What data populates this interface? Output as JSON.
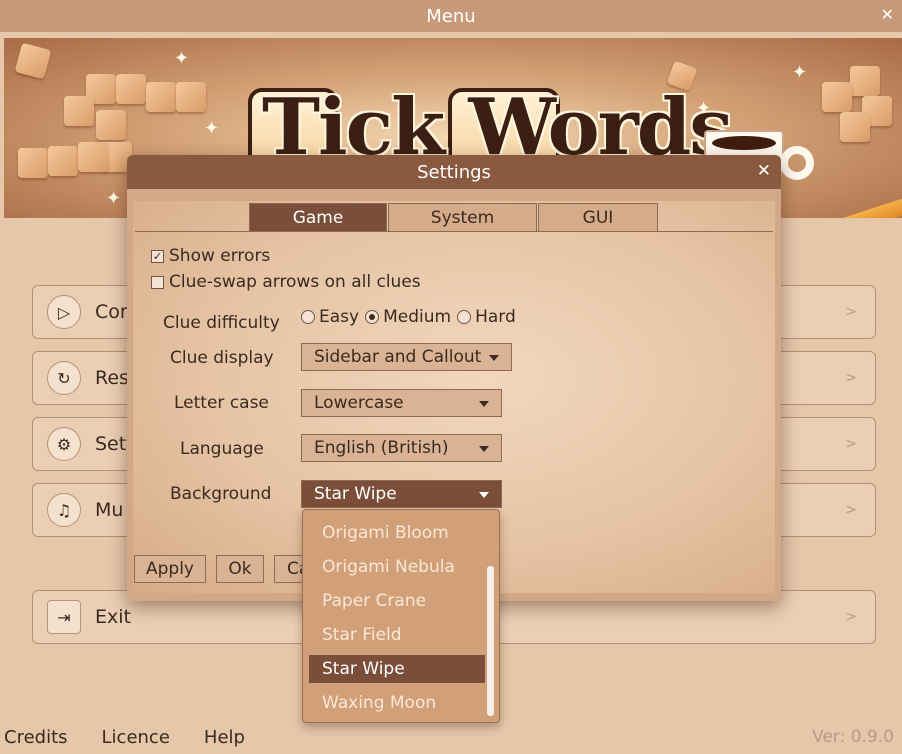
{
  "window": {
    "title": "Menu",
    "close_glyph": "✕"
  },
  "banner": {
    "logo_title": "Tick Words"
  },
  "menu": {
    "items": [
      {
        "label": "Con",
        "icon": "play-icon",
        "glyph": "▷",
        "chevron": ">"
      },
      {
        "label": "Res",
        "icon": "restart-icon",
        "glyph": "↻",
        "chevron": ">"
      },
      {
        "label": "Sett",
        "icon": "gear-icon",
        "glyph": "⚙",
        "chevron": ">"
      },
      {
        "label": "Mu",
        "icon": "music-icon",
        "glyph": "♫",
        "chevron": ">"
      },
      {
        "label": "Exit",
        "icon": "exit-icon",
        "glyph": "⇥",
        "chevron": ">"
      }
    ]
  },
  "footer": {
    "credits": "Credits",
    "licence": "Licence",
    "help": "Help",
    "version": "Ver: 0.9.0"
  },
  "settings": {
    "title": "Settings",
    "close_glyph": "✕",
    "tabs": [
      {
        "label": "Game",
        "active": true
      },
      {
        "label": "System",
        "active": false
      },
      {
        "label": "GUI",
        "active": false
      }
    ],
    "show_errors": {
      "label": "Show errors",
      "checked": true,
      "glyph": "✓"
    },
    "clue_swap": {
      "label": "Clue-swap arrows on all clues",
      "checked": false
    },
    "clue_difficulty": {
      "label": "Clue difficulty",
      "options": [
        "Easy",
        "Medium",
        "Hard"
      ],
      "selected": "Medium"
    },
    "clue_display": {
      "label": "Clue display",
      "value": "Sidebar and Callout"
    },
    "letter_case": {
      "label": "Letter case",
      "value": "Lowercase"
    },
    "language": {
      "label": "Language",
      "value": "English (British)"
    },
    "background": {
      "label": "Background",
      "value": "Star Wipe",
      "options": [
        "Origami Bloom",
        "Origami Nebula",
        "Paper Crane",
        "Star Field",
        "Star Wipe",
        "Waxing Moon"
      ]
    },
    "buttons": {
      "apply": "Apply",
      "ok": "Ok",
      "cancel": "Ca"
    }
  },
  "colors": {
    "title_bar": "#c79a79",
    "dialog_title_bar": "#8a5a40",
    "active_accent": "#7a4e38",
    "background": "#e6c7aa"
  }
}
